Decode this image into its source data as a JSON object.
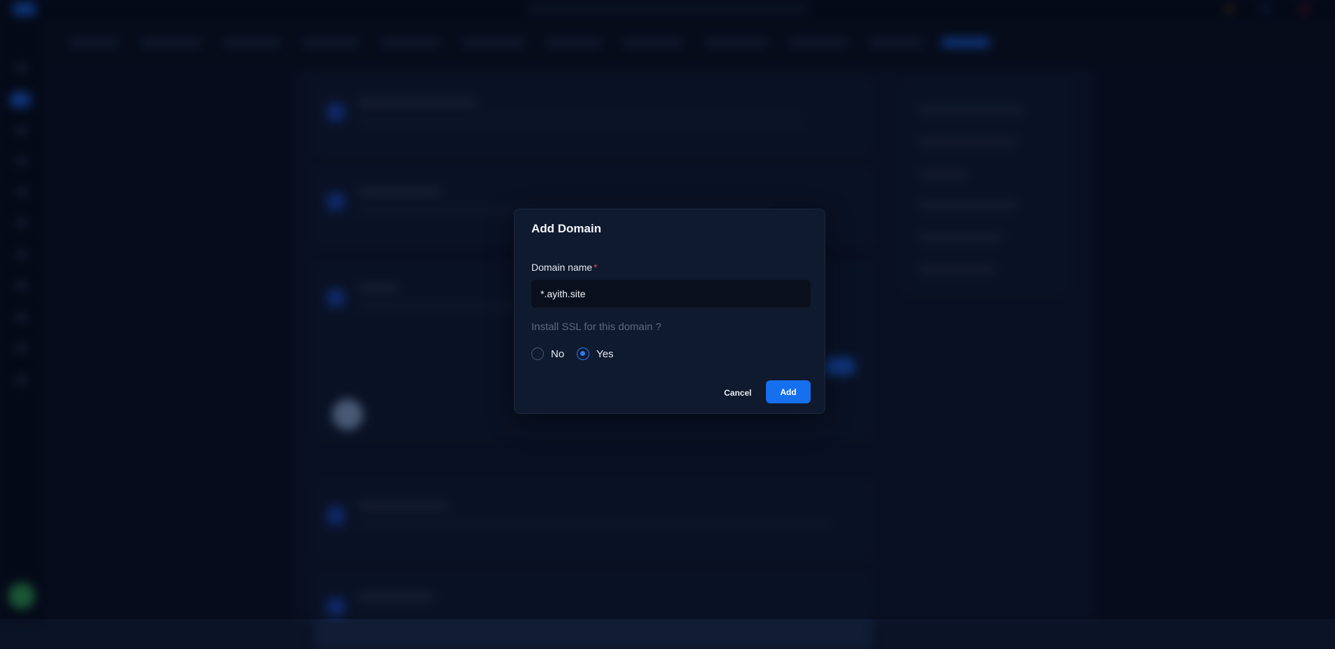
{
  "colors": {
    "accent": "#1570ef",
    "modal_bg": "#101a2e",
    "input_bg": "#0a0f1c",
    "required": "#e0454b",
    "muted_text": "#5c6780"
  },
  "modal": {
    "title": "Add Domain",
    "domain_field": {
      "label": "Domain name",
      "required_marker": "*",
      "value": "*.ayith.site"
    },
    "ssl": {
      "question": "Install SSL for this domain ?",
      "options": [
        {
          "label": "No",
          "checked": false
        },
        {
          "label": "Yes",
          "checked": true
        }
      ]
    },
    "buttons": {
      "cancel": "Cancel",
      "add": "Add"
    }
  }
}
